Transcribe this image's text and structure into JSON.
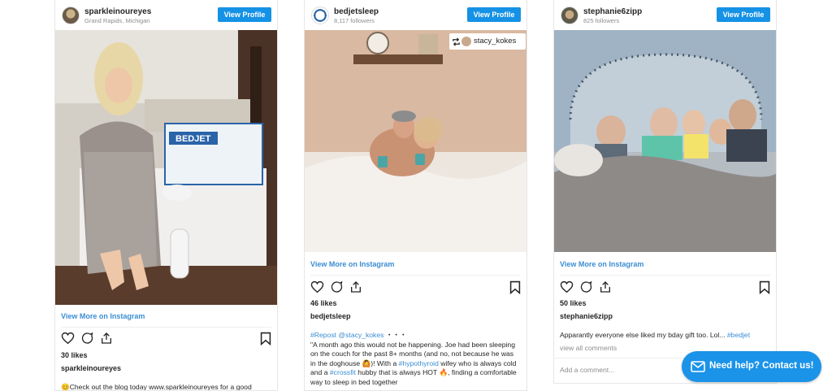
{
  "cards": [
    {
      "username": "sparkleinoureyes",
      "subtitle": "Grand Rapids, Michigan",
      "view_profile": "View Profile",
      "view_more": "View More on Instagram",
      "likes": "30 likes",
      "author": "sparkleinoureyes",
      "caption": "😊Check out the blog today www.sparkleinoureyes for a good"
    },
    {
      "username": "bedjetsleep",
      "subtitle": "8,117 followers",
      "view_profile": "View Profile",
      "repost_user": "stacy_kokes",
      "view_more": "View More on Instagram",
      "likes": "46 likes",
      "author": "bedjetsleep",
      "caption_tag1": "#Repost",
      "caption_tag2": "@stacy_kokes",
      "caption_dots": "・・・",
      "caption_p1": "\"A month ago this would not be happening. Joe had been sleeping on the couch for the past 8+ months (and no, not because he was in the doghouse 🙆)! With a ",
      "caption_tag3": "#hypothyroid",
      "caption_p2": " wifey who is always cold and a ",
      "caption_tag4": "#crossfit",
      "caption_p3": " hubby that is always HOT 🔥, finding a comfortable way to sleep in bed together"
    },
    {
      "username": "stephanie6zipp",
      "subtitle": "825 followers",
      "view_profile": "View Profile",
      "view_more": "View More on Instagram",
      "likes": "50 likes",
      "author": "stephanie6zipp",
      "caption_text": "Apparantly everyone else liked my bday gift too. Lol... ",
      "caption_tag": "#bedjet",
      "view_comments": "view all comments",
      "add_comment": "Add a comment..."
    }
  ],
  "chat": {
    "label": "Need help? Contact us!"
  },
  "colors": {
    "accent": "#1592e6",
    "link": "#3b8dd3"
  }
}
